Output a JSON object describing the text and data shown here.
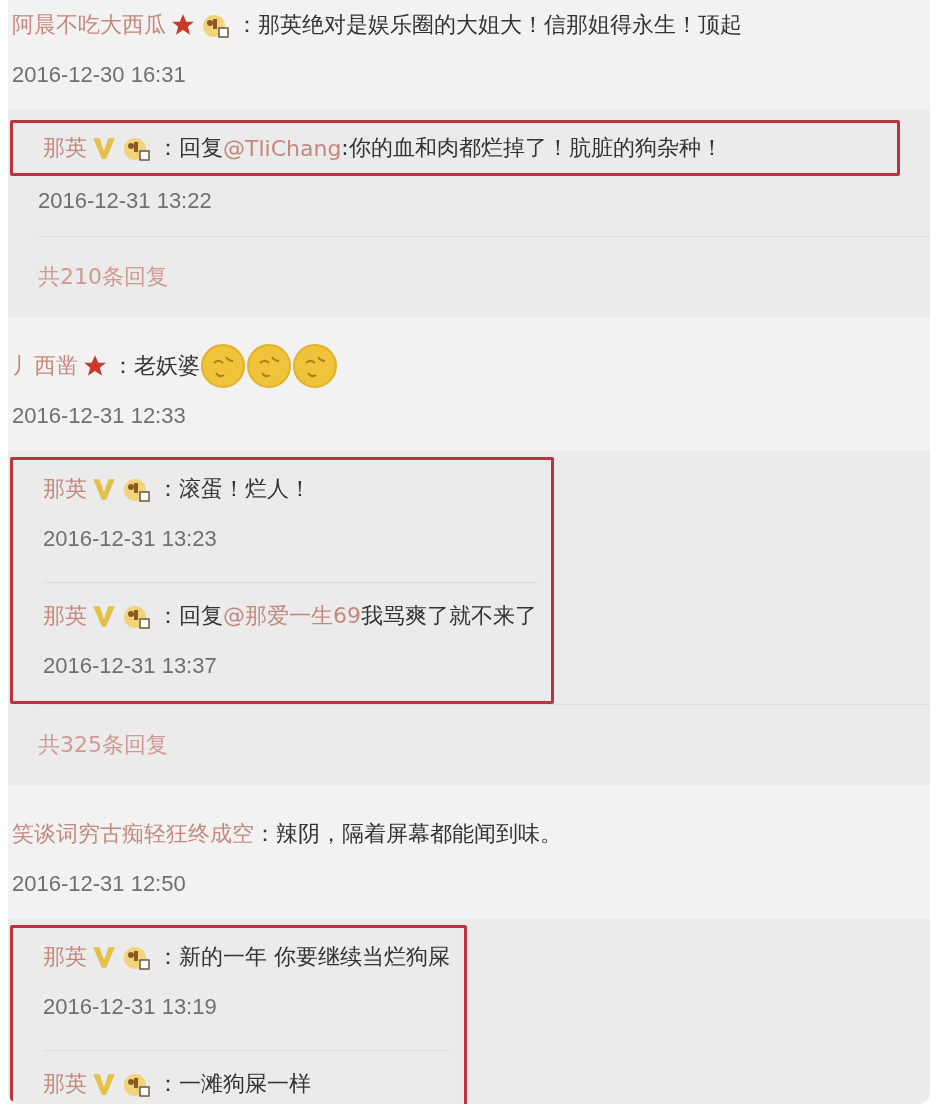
{
  "comments": [
    {
      "name": "阿晨不吃大西瓜",
      "badges": [
        {
          "kind": "star"
        },
        {
          "kind": "vip"
        }
      ],
      "text": "：那英绝对是娱乐圈的大姐大！信那姐得永生！顶起",
      "time": "2016-12-30 16:31",
      "highlight": {
        "kind": "first-line"
      },
      "replies": [
        {
          "name": "那英",
          "badges": [
            {
              "kind": "verified"
            },
            {
              "kind": "vip"
            }
          ],
          "text": "：回复",
          "mention": "@TliChang",
          "rest": ":你的血和肉都烂掉了！肮脏的狗杂种！",
          "time": "2016-12-31 13:22"
        }
      ],
      "more": "共210条回复"
    },
    {
      "name": "丿西凿",
      "badges": [
        {
          "kind": "star"
        }
      ],
      "text": "：老妖婆",
      "emojis": [
        {
          "kind": "coin"
        },
        {
          "kind": "coin"
        },
        {
          "kind": "coin"
        }
      ],
      "time": "2016-12-31 12:33",
      "highlight": {
        "kind": "all-replies"
      },
      "replies": [
        {
          "name": "那英",
          "badges": [
            {
              "kind": "verified"
            },
            {
              "kind": "vip"
            }
          ],
          "text": "：滚蛋！烂人！",
          "time": "2016-12-31 13:23"
        },
        {
          "name": "那英",
          "badges": [
            {
              "kind": "verified"
            },
            {
              "kind": "vip"
            }
          ],
          "text": "：回复",
          "mention": "@那爱一生69",
          "rest": "我骂爽了就不来了",
          "time": "2016-12-31 13:37"
        }
      ],
      "more": "共325条回复"
    },
    {
      "name": "笑谈词穷古痴轻狂终成空",
      "text": "：辣阴，隔着屏幕都能闻到味。",
      "time": "2016-12-31 12:50",
      "highlight": {
        "kind": "all-replies"
      },
      "replies": [
        {
          "name": "那英",
          "badges": [
            {
              "kind": "verified"
            },
            {
              "kind": "vip"
            }
          ],
          "text": "：新的一年 你要继续当烂狗屎",
          "time": "2016-12-31 13:19"
        },
        {
          "name": "那英",
          "badges": [
            {
              "kind": "verified"
            },
            {
              "kind": "vip"
            }
          ],
          "text": "：一滩狗屎一样"
        }
      ]
    }
  ]
}
